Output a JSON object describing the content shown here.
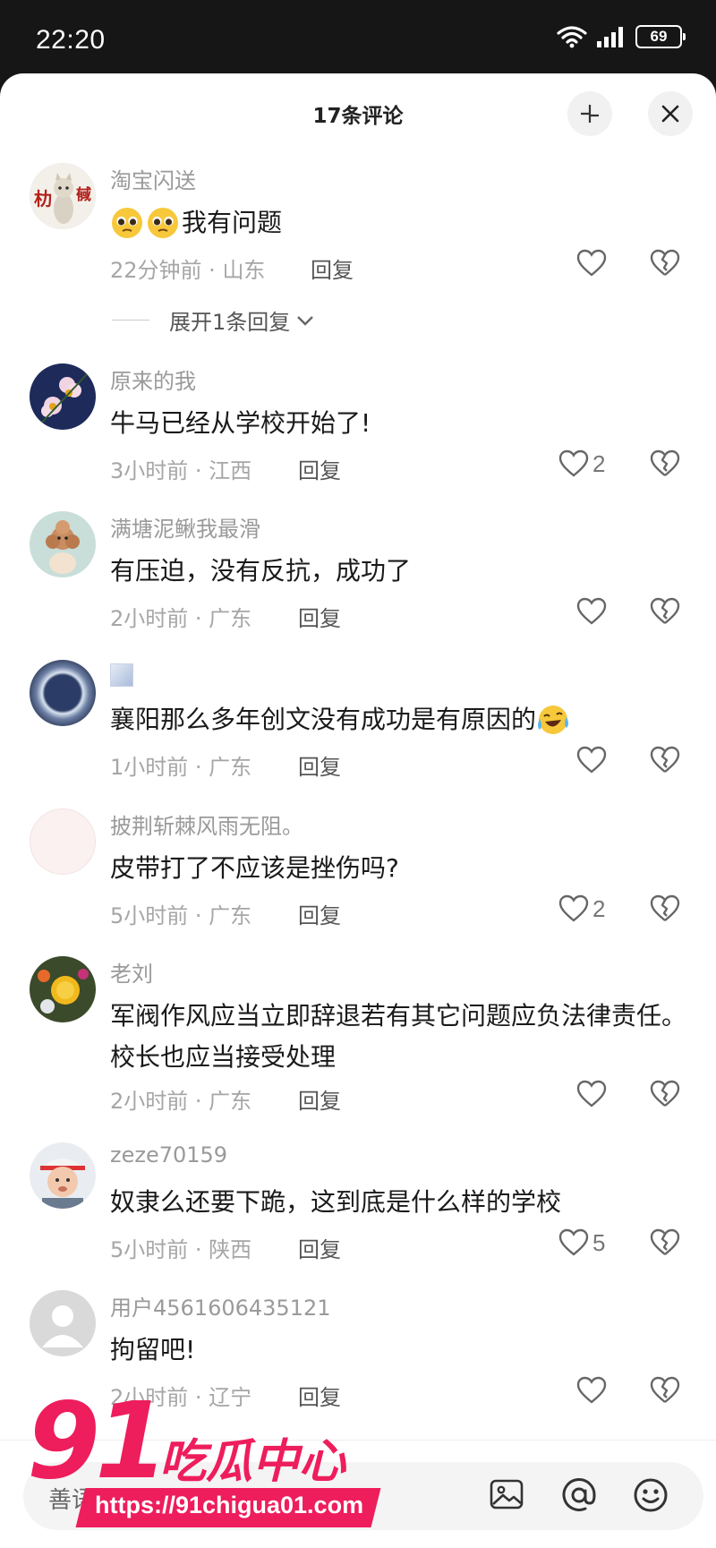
{
  "status_bar": {
    "time": "22:20",
    "battery": "69"
  },
  "header": {
    "title": "17条评论",
    "collapse_icon": "collapse-icon",
    "close_icon": "close-icon"
  },
  "comments": [
    {
      "user": "淘宝闪送",
      "text": "我有问题",
      "emoji": "pleading-face",
      "time": "22分钟前",
      "location": "山东",
      "likes": "",
      "expand_label": "展开1条回复",
      "avatar": "cat-figure"
    },
    {
      "user": "原来的我",
      "text": "牛马已经从学校开始了!",
      "time": "3小时前",
      "location": "江西",
      "likes": "2",
      "avatar": "flowers"
    },
    {
      "user": "满塘泥鳅我最滑",
      "text": "有压迫，没有反抗，成功了",
      "time": "2小时前",
      "location": "广东",
      "likes": "",
      "avatar": "poodle"
    },
    {
      "user": "",
      "text": "襄阳那么多年创文没有成功是有原因的",
      "emoji": "crying-laughing-face",
      "time": "1小时前",
      "location": "广东",
      "likes": "",
      "avatar": "halo-sky"
    },
    {
      "user": "披荆斩棘风雨无阻。",
      "text": "皮带打了不应该是挫伤吗?",
      "time": "5小时前",
      "location": "广东",
      "likes": "2",
      "avatar": "blank-pink"
    },
    {
      "user": "老刘",
      "text": "军阀作风应当立即辞退若有其它问题应负法律责任。校长也应当接受处理",
      "time": "2小时前",
      "location": "广东",
      "likes": "",
      "avatar": "chrysanthemum"
    },
    {
      "user": "zeze70159",
      "text": "奴隶么还要下跪，这到底是什么样的学校",
      "time": "5小时前",
      "location": "陕西",
      "likes": "5",
      "avatar": "baby"
    },
    {
      "user": "用户4561606435121",
      "text": "拘留吧!",
      "time": "2小时前",
      "location": "辽宁",
      "likes": "",
      "avatar": "default-user"
    }
  ],
  "reply_label": "回复",
  "meta_separator": " · ",
  "bottom_bar": {
    "placeholder": "善语",
    "icons": [
      "image-icon",
      "at-icon",
      "emoji-icon"
    ]
  },
  "watermark": {
    "number": "91",
    "name": "吃瓜中心",
    "url": "https://91chigua01.com"
  },
  "colors": {
    "watermark": "#ee1d5c",
    "background": "#ffffff",
    "status_bar": "#161616"
  }
}
